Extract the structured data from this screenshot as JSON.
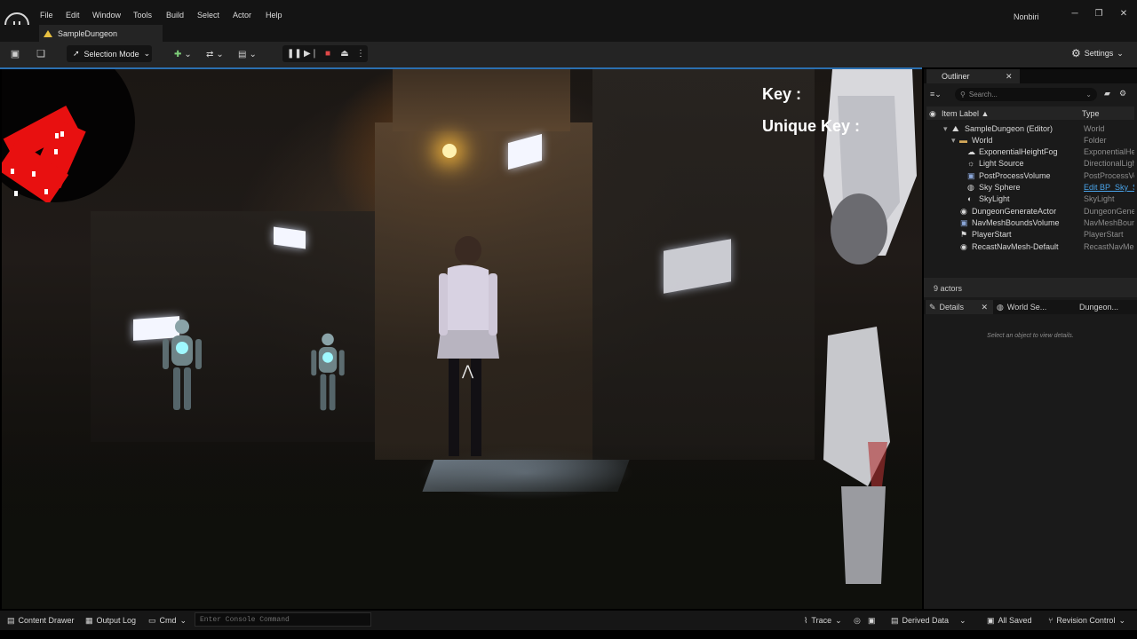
{
  "app": {
    "logo": "unreal-engine-logo",
    "menu": [
      "File",
      "Edit",
      "Window",
      "Tools",
      "Build",
      "Select",
      "Actor",
      "Help"
    ],
    "user": "Nonbiri",
    "window_controls": {
      "minimize": "─",
      "maximize": "❐",
      "close": "✕"
    }
  },
  "tab": {
    "level_name": "SampleDungeon"
  },
  "toolbar": {
    "mode_label": "Selection Mode",
    "settings_label": "Settings"
  },
  "viewport": {
    "hud_key": "Key :",
    "hud_unique_key": "Unique Key :"
  },
  "outliner": {
    "title": "Outliner",
    "search_placeholder": "Search...",
    "col_item_label": "Item Label ▲",
    "col_type": "Type",
    "rows": [
      {
        "label": "SampleDungeon (Editor)",
        "type": "World"
      },
      {
        "label": "World",
        "type": "Folder"
      },
      {
        "label": "ExponentialHeightFog",
        "type": "ExponentialHei"
      },
      {
        "label": "Light Source",
        "type": "DirectionalLigh"
      },
      {
        "label": "PostProcessVolume",
        "type": "PostProcessVo"
      },
      {
        "label": "Sky Sphere",
        "type": "Edit BP_Sky_Sp"
      },
      {
        "label": "SkyLight",
        "type": "SkyLight"
      },
      {
        "label": "DungeonGenerateActor",
        "type": "DungeonGener"
      },
      {
        "label": "NavMeshBoundsVolume",
        "type": "NavMeshBound"
      },
      {
        "label": "PlayerStart",
        "type": "PlayerStart"
      },
      {
        "label": "RecastNavMesh-Default",
        "type": "RecastNavMes"
      }
    ],
    "actor_count": "9 actors"
  },
  "details": {
    "tab_details": "Details",
    "tab_world_settings": "World Se...",
    "tab_dungeon": "Dungeon...",
    "empty_message": "Select an object to view details."
  },
  "statusbar": {
    "content_drawer": "Content Drawer",
    "output_log": "Output Log",
    "cmd": "Cmd",
    "console_placeholder": "Enter Console Command",
    "trace": "Trace",
    "derived_data": "Derived Data",
    "all_saved": "All Saved",
    "revision_control": "Revision Control"
  },
  "colors": {
    "accent": "#2b6fb0",
    "minimap_red": "#e81010",
    "sky_link": "#4aa3e8"
  }
}
